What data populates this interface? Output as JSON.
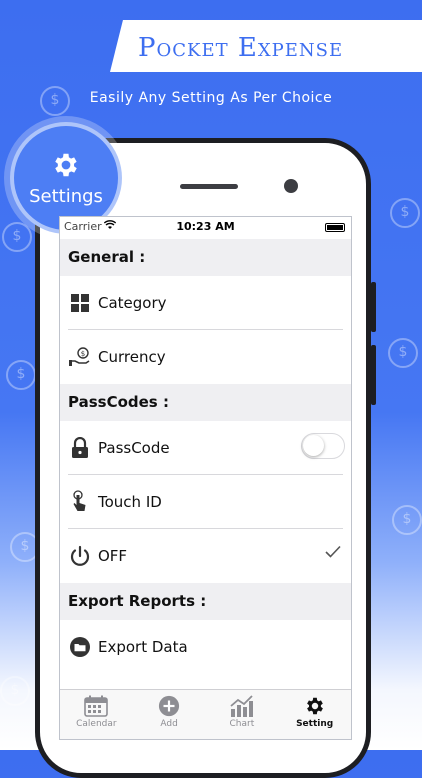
{
  "banner": {
    "title": "Pocket Expense",
    "tagline": "Easily Any Setting As Per Choice"
  },
  "badge": {
    "label": "Settings",
    "icon": "gear-icon"
  },
  "status_bar": {
    "carrier": "Carrier",
    "time": "10:23 AM"
  },
  "sections": {
    "general": "General :",
    "passcodes": "PassCodes :",
    "export": "Export Reports :"
  },
  "rows": {
    "category": {
      "label": "Category",
      "icon": "grid-icon"
    },
    "currency": {
      "label": "Currency",
      "icon": "money-hand-icon"
    },
    "passcode": {
      "label": "PassCode",
      "icon": "lock-icon",
      "enabled": false
    },
    "touch_id": {
      "label": "Touch ID",
      "icon": "fingerprint-icon"
    },
    "off": {
      "label": "OFF",
      "icon": "power-icon",
      "checked": true
    },
    "export_data": {
      "label": "Export Data",
      "icon": "folder-icon"
    }
  },
  "tabs": [
    {
      "label": "Calendar",
      "icon": "calendar-icon",
      "active": false
    },
    {
      "label": "Add",
      "icon": "add-circle-icon",
      "active": false
    },
    {
      "label": "Chart",
      "icon": "chart-icon",
      "active": false
    },
    {
      "label": "Setting",
      "icon": "gear-icon",
      "active": true
    }
  ],
  "colors": {
    "accent": "#3d6ef0",
    "text": "#111111",
    "section_bg": "#efeff2"
  }
}
